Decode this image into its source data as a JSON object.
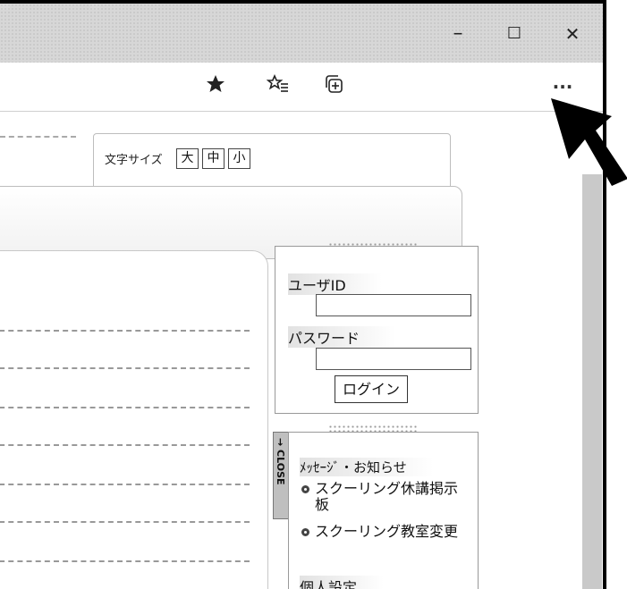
{
  "window": {
    "minimize_glyph": "–",
    "maximize_glyph": "☐",
    "close_glyph": "✕"
  },
  "toolbar": {
    "favorite_icon": "star-icon",
    "favorites_icon": "favorites-list-icon",
    "collections_icon": "collections-icon",
    "more_glyph": "···"
  },
  "font_size": {
    "label": "文字サイズ",
    "large": "大",
    "medium": "中",
    "small": "小"
  },
  "login": {
    "user_id_label": "ユーザID",
    "password_label": "パスワード",
    "login_button": "ログイン"
  },
  "side_tab": {
    "close_label": "→ CLOSE"
  },
  "messages": {
    "title": "ﾒｯｾｰｼﾞ・お知らせ",
    "items": [
      "スクーリング休講掲示板",
      "スクーリング教室変更"
    ],
    "personal_settings": "個人設定"
  },
  "colors": {
    "titlebar": "#d7d7d7",
    "scrollbar": "#c9c9c9",
    "accent": "#000000"
  }
}
